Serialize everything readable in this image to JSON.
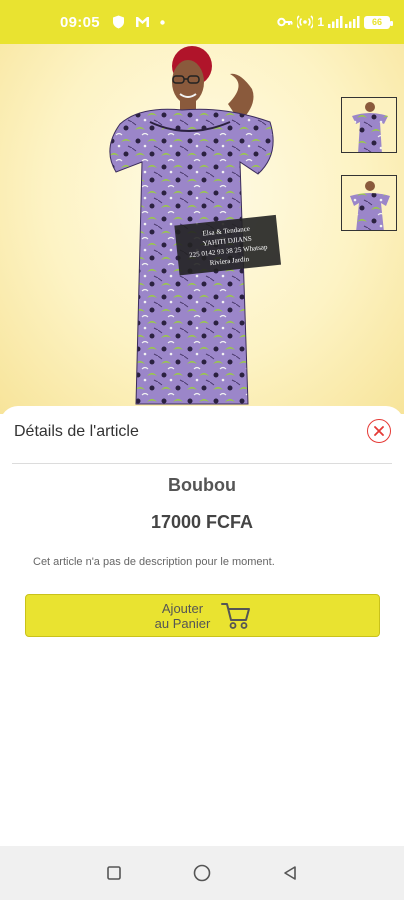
{
  "status_bar": {
    "time": "09:05",
    "network_indicator": "1",
    "battery_level": "66",
    "icons": [
      "shield-icon",
      "gmail-icon",
      "dot-icon",
      "key-icon",
      "hotspot-icon",
      "signal-icon",
      "battery-icon"
    ]
  },
  "product_image": {
    "sign_text": "Elsa & Tendance\nYAHITI DJIANS\n225 0142 93 38 25 Whatsap\nRiviera Jardin",
    "thumbnails": [
      "thumbnail-1",
      "thumbnail-2"
    ]
  },
  "sheet": {
    "title": "Détails de l'article",
    "product_name": "Boubou",
    "product_price": "17000 FCFA",
    "description": "Cet article n'a pas de description pour le moment.",
    "add_to_cart_label": "Ajouter au Panier"
  },
  "colors": {
    "accent": "#e9e330",
    "close": "#e53935",
    "dress_purple": "#9b86c9",
    "dress_green": "#9ad13a"
  },
  "nav_bar": {
    "buttons": [
      "recents-button",
      "home-button",
      "back-button"
    ]
  }
}
